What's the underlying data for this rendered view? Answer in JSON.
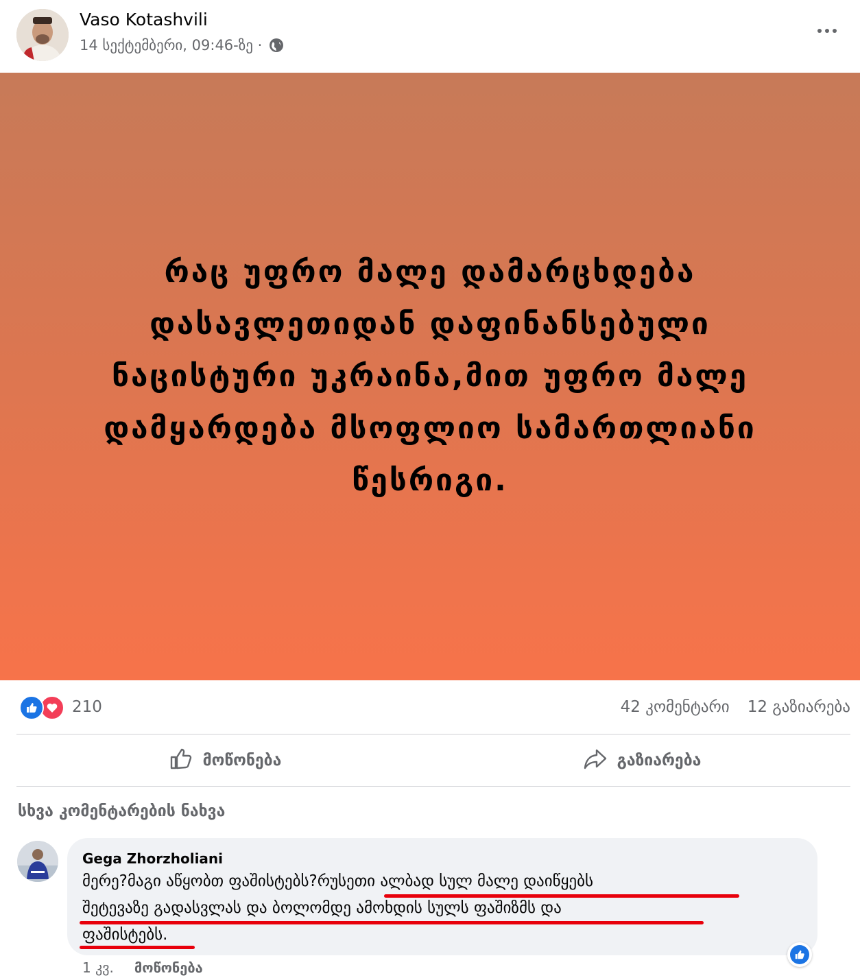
{
  "post": {
    "author": "Vaso Kotashvili",
    "timestamp": "14 სექტემბერი, 09:46-ზე ·",
    "privacy_icon": "globe-icon",
    "menu_icon": "more-options-icon",
    "card_text": "რაც უფრო მალე დამარცხდება დასავლეთიდან დაფინანსებული ნაცისტური უკრაინა,მით უფრო მალე დამყარდება მსოფლიო სამართლიანი წესრიგი.",
    "card_gradient": [
      "#c77a58",
      "#f7734a"
    ]
  },
  "stats": {
    "reaction_count": "210",
    "comments": "42 კომენტარი",
    "shares": "12 გაზიარება",
    "reaction_icons": [
      "like-icon",
      "love-icon"
    ]
  },
  "actions": {
    "like_label": "მოწონება",
    "share_label": "გაზიარება"
  },
  "comments_section": {
    "view_more": "სხვა კომენტარების ნახვა",
    "comment": {
      "author": "Gega Zhorzholiani",
      "line1": "მერე?მაგი აწყობთ ფაშისტებს?რუსეთი ალბად სულ მალე დაიწყებს",
      "line2": "შეტევაზე გადასვლას და ბოლომდე ამოხდის სულს ფაშიზმს და",
      "line3": "ფაშისტებს.",
      "time": "1 კვ.",
      "like_link": "მოწონება",
      "underline_color": "#e8000b"
    }
  },
  "colors": {
    "accent": "#1b74e4",
    "love": "#f33e58",
    "secondary_text": "#65676b"
  }
}
